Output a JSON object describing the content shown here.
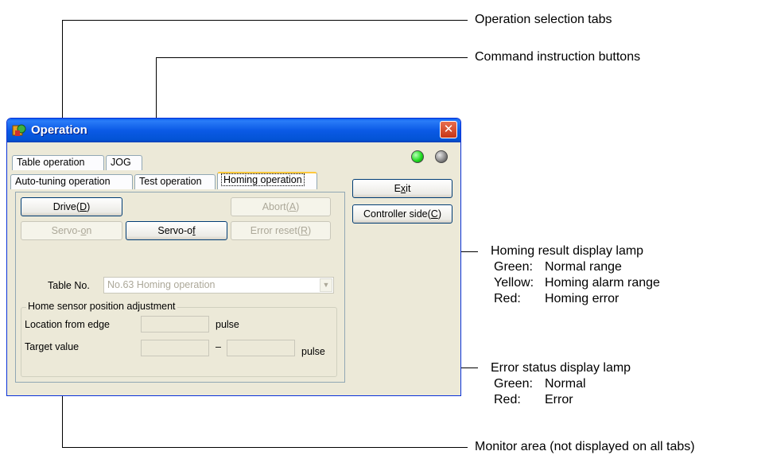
{
  "callouts": {
    "tabs": "Operation selection tabs",
    "commands": "Command instruction buttons",
    "homing_lamp": {
      "title": "Homing result display lamp",
      "rows": [
        {
          "key": "Green:",
          "value": "Normal range"
        },
        {
          "key": "Yellow:",
          "value": "Homing alarm range"
        },
        {
          "key": "Red:",
          "value": "Homing error"
        }
      ]
    },
    "error_lamp": {
      "title": "Error status display lamp",
      "rows": [
        {
          "key": "Green:",
          "value": "Normal"
        },
        {
          "key": "Red:",
          "value": "Error"
        }
      ]
    },
    "monitor": "Monitor area (not displayed on all tabs)"
  },
  "window": {
    "title": "Operation",
    "close_label": "✕",
    "app_icon": "operation-app-icon"
  },
  "tabs": {
    "row1": [
      "Table operation",
      "JOG"
    ],
    "row2": [
      "Auto-tuning operation",
      "Test operation",
      "Homing operation"
    ],
    "active": "Homing operation"
  },
  "buttons": {
    "drive": {
      "label": "Drive(",
      "key": "D",
      "end": ")"
    },
    "abort": {
      "label": "Abort(",
      "key": "A",
      "end": ")"
    },
    "servo_on": {
      "label": "Servo-",
      "key": "o",
      "end": "n"
    },
    "servo_off": {
      "label": "Servo-o",
      "key": "f",
      "end": "f"
    },
    "error_reset": {
      "label": "Error reset(",
      "key": "R",
      "end": ")"
    },
    "exit": {
      "label": "E",
      "key": "x",
      "end": "it"
    },
    "controller_side": {
      "label": "Controller side(",
      "key": "C",
      "end": ")"
    }
  },
  "table": {
    "label": "Table No.",
    "value": "No.63 Homing operation"
  },
  "adjustment": {
    "title": "Home sensor position adjustment",
    "location_label": "Location from edge",
    "location_unit": "pulse",
    "target_label": "Target value",
    "target_sep": "–",
    "target_unit": "pulse"
  },
  "lamps": {
    "error": {
      "color": "#22dd22",
      "status": "green"
    },
    "homing": {
      "color": "#8a8a8a",
      "status": "gray"
    }
  },
  "colors": {
    "titlebar": "#0353d4",
    "face": "#ece9d8",
    "disabled_text": "#aca899"
  }
}
